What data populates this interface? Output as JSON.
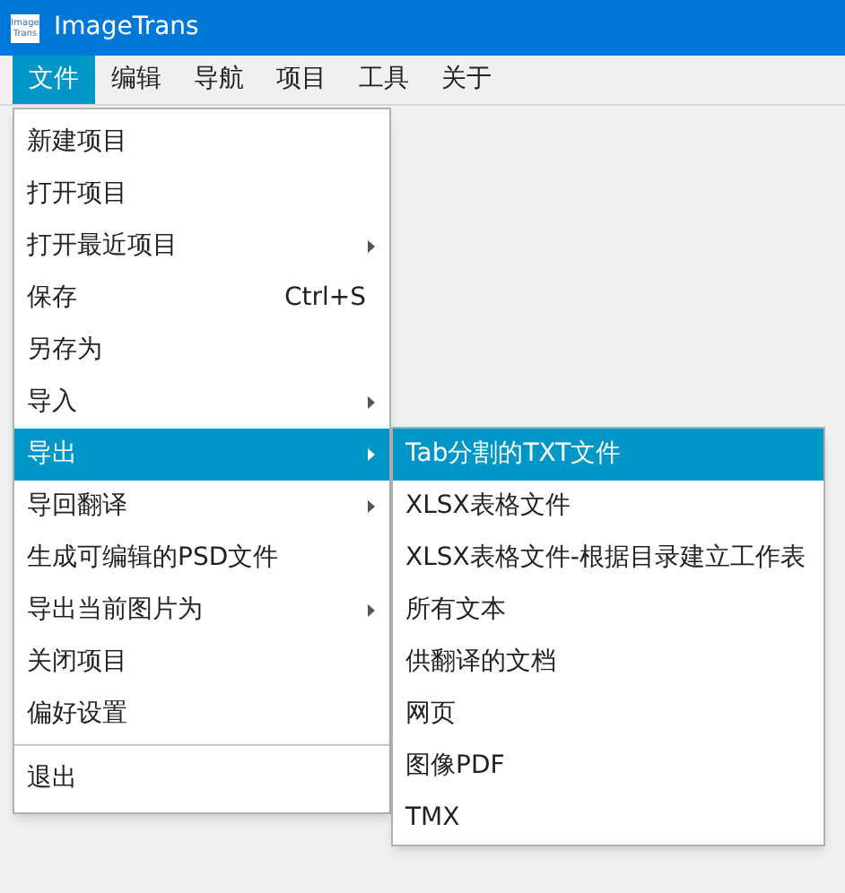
{
  "window": {
    "title": "ImageTrans",
    "logo_lines": [
      "Image",
      "Trans"
    ]
  },
  "menu_bar": [
    {
      "label": "文件",
      "selected": true
    },
    {
      "label": "编辑",
      "selected": false
    },
    {
      "label": "导航",
      "selected": false
    },
    {
      "label": "项目",
      "selected": false
    },
    {
      "label": "工具",
      "selected": false
    },
    {
      "label": "关于",
      "selected": false
    }
  ],
  "file_menu": [
    {
      "label": "新建项目",
      "submenu": false,
      "selected": false,
      "separator_before": false
    },
    {
      "label": "打开项目",
      "submenu": false,
      "selected": false,
      "separator_before": false
    },
    {
      "label": "打开最近项目",
      "submenu": true,
      "selected": false,
      "separator_before": false
    },
    {
      "label": "保存",
      "shortcut": "Ctrl+S",
      "submenu": false,
      "selected": false,
      "separator_before": false
    },
    {
      "label": "另存为",
      "submenu": false,
      "selected": false,
      "separator_before": false
    },
    {
      "label": "导入",
      "submenu": true,
      "selected": false,
      "separator_before": false
    },
    {
      "label": "导出",
      "submenu": true,
      "selected": true,
      "separator_before": false
    },
    {
      "label": "导回翻译",
      "submenu": true,
      "selected": false,
      "separator_before": false
    },
    {
      "label": "生成可编辑的PSD文件",
      "submenu": false,
      "selected": false,
      "separator_before": false
    },
    {
      "label": "导出当前图片为",
      "submenu": true,
      "selected": false,
      "separator_before": false
    },
    {
      "label": "关闭项目",
      "submenu": false,
      "selected": false,
      "separator_before": false
    },
    {
      "label": "偏好设置",
      "submenu": false,
      "selected": false,
      "separator_before": false
    },
    {
      "label": "退出",
      "submenu": false,
      "selected": false,
      "separator_before": true
    }
  ],
  "export_submenu": [
    {
      "label": "Tab分割的TXT文件",
      "selected": true
    },
    {
      "label": "XLSX表格文件",
      "selected": false
    },
    {
      "label": "XLSX表格文件-根据目录建立工作表",
      "selected": false
    },
    {
      "label": "所有文本",
      "selected": false
    },
    {
      "label": "供翻译的文档",
      "selected": false
    },
    {
      "label": "网页",
      "selected": false
    },
    {
      "label": "图像PDF",
      "selected": false
    },
    {
      "label": "TMX",
      "selected": false
    }
  ]
}
